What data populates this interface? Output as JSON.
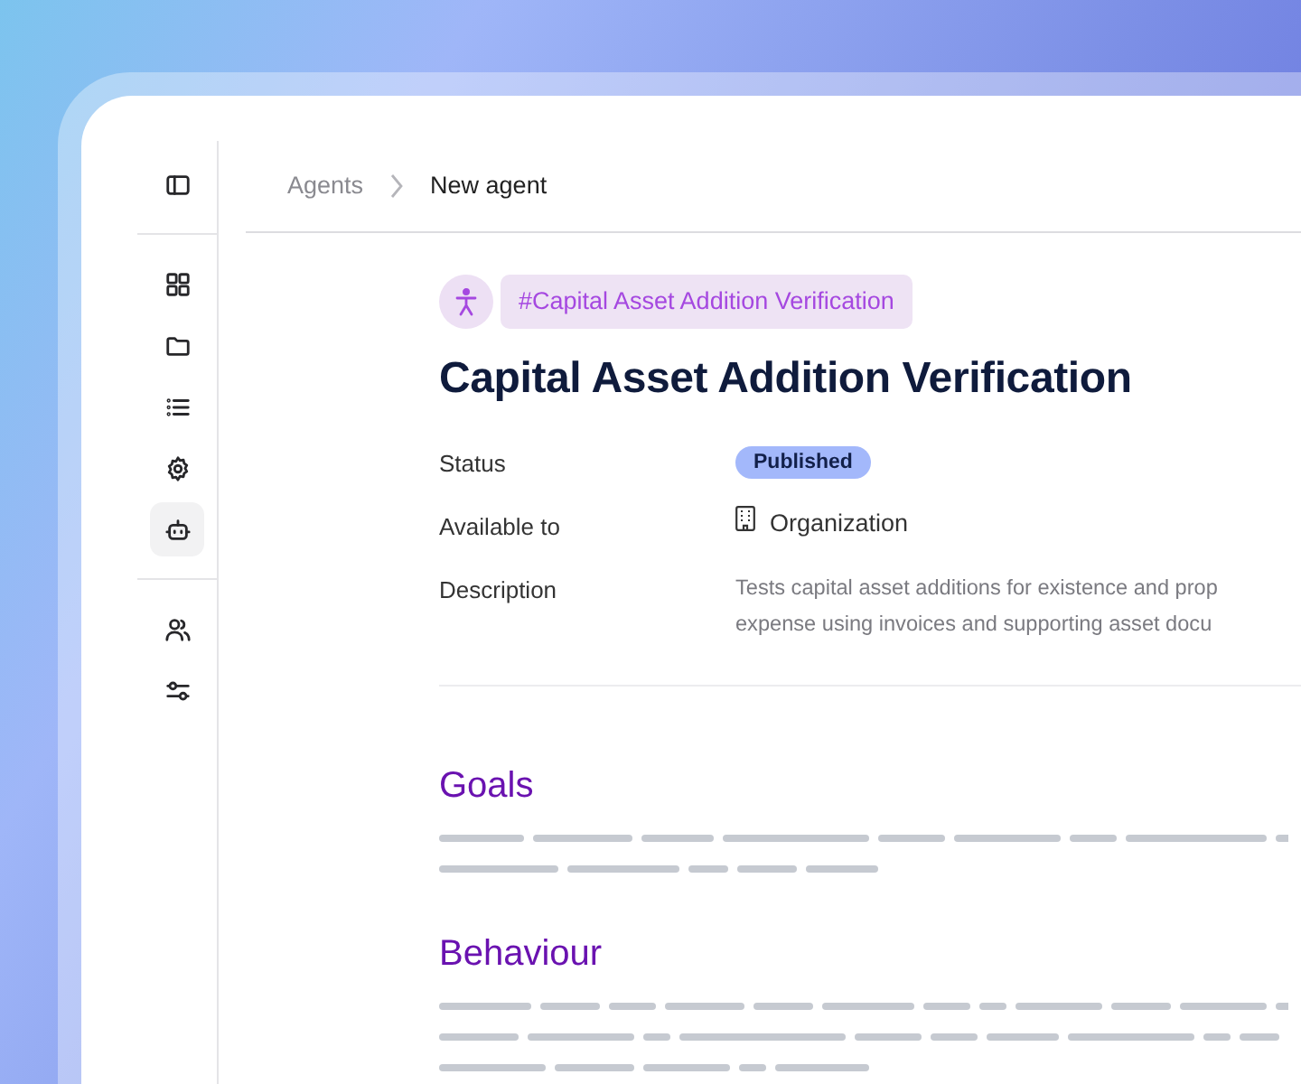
{
  "sidebar": {
    "toggle": {
      "kind": "panel"
    },
    "groups": [
      [
        {
          "kind": "grid",
          "selected": false
        },
        {
          "kind": "folder",
          "selected": false
        },
        {
          "kind": "list",
          "selected": false
        },
        {
          "kind": "gear",
          "selected": false
        },
        {
          "kind": "bot",
          "selected": true
        }
      ],
      [
        {
          "kind": "users",
          "selected": false
        },
        {
          "kind": "sliders",
          "selected": false
        }
      ]
    ]
  },
  "breadcrumb": [
    "Agents",
    "New agent"
  ],
  "agent": {
    "tag": "#Capital Asset Addition Verification",
    "title": "Capital Asset Addition Verification"
  },
  "details": [
    {
      "label": "Status",
      "kind": "badge",
      "value": "Published"
    },
    {
      "label": "Available to",
      "kind": "org",
      "value": "Organization"
    },
    {
      "label": "Description",
      "kind": "text",
      "lines": [
        "Tests capital asset additions for existence and prop",
        "expense using invoices and supporting asset docu"
      ]
    }
  ],
  "sections": [
    {
      "heading": "Goals"
    },
    {
      "heading": "Behaviour"
    }
  ]
}
